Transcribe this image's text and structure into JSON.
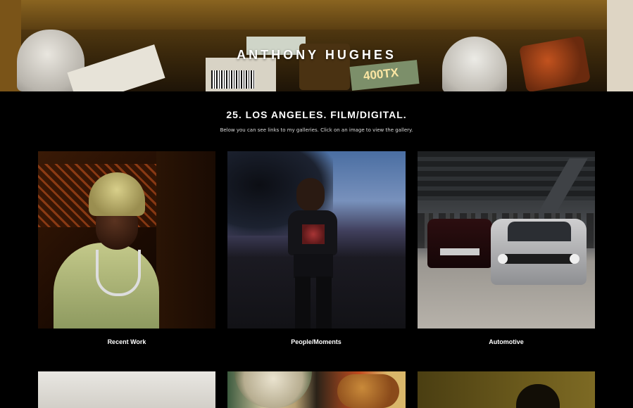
{
  "site": {
    "name": "ANTHONY HUGHES"
  },
  "hero": {
    "film_label": "400TX"
  },
  "intro": {
    "title": "25. LOS ANGELES. FILM/DIGITAL.",
    "subtitle": "Below you can see links to my galleries. Click on an image to view the gallery."
  },
  "galleries": [
    {
      "label": "Recent Work"
    },
    {
      "label": "People/Moments"
    },
    {
      "label": "Automotive"
    }
  ]
}
